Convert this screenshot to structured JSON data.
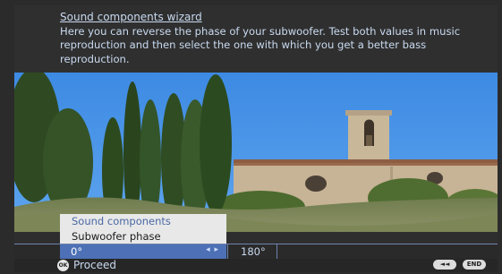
{
  "wizard": {
    "title": "Sound components wizard",
    "description": "Here you can reverse the phase of your subwoofer. Test both values in music reproduction and then select the one with which you get a better bass reproduction."
  },
  "menu": {
    "breadcrumb": "Sound components",
    "item_label": "Subwoofer phase"
  },
  "values": {
    "selected": "0°",
    "alternative": "180°",
    "arrows_icon": "left-right-arrows-icon"
  },
  "footer": {
    "ok_key": "OK",
    "proceed_label": "Proceed",
    "rewind_key": "◄◄",
    "end_key": "END"
  },
  "colors": {
    "accent": "#4d70b6",
    "text": "#c9daf0",
    "sky": "#3f8ee6"
  }
}
